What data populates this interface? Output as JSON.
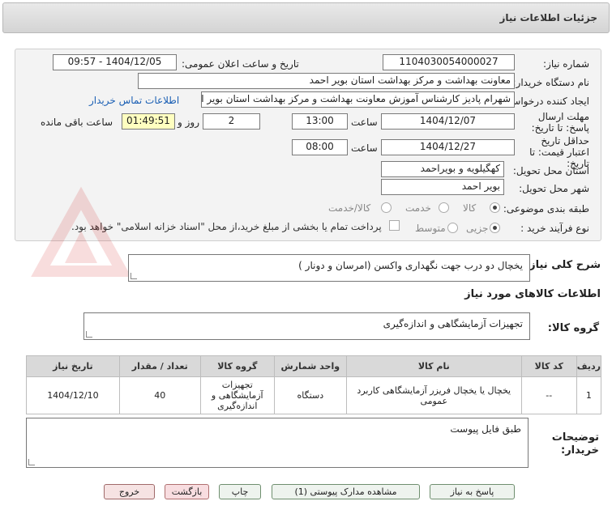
{
  "header": {
    "title": "جزئیات اطلاعات نیاز"
  },
  "fields": {
    "need_number_label": "شماره نیاز:",
    "need_number": "1104030054000027",
    "announce_label": "تاریخ و ساعت اعلان عمومی:",
    "announce_value": "1404/12/05 - 09:57",
    "buyer_org_label": "نام دستگاه خریدار:",
    "buyer_org": "معاونت بهداشت و مرکز بهداشت استان بویر احمد",
    "requester_label": "ایجاد کننده درخواست:",
    "requester": "شهرام پادیز کارشناس آموزش معاونت بهداشت و مرکز بهداشت استان بویر احمد",
    "contact_link": "اطلاعات تماس خریدار",
    "deadline_label": "مهلت ارسال پاسخ: تا تاریخ:",
    "deadline_date": "1404/12/07",
    "time_label": "ساعت",
    "deadline_time": "13:00",
    "days_value": "2",
    "days_label": "روز و",
    "remaining_time": "01:49:51",
    "remaining_label": "ساعت باقی مانده",
    "validity_label": "حداقل تاریخ اعتبار قیمت: تا تاریخ:",
    "validity_date": "1404/12/27",
    "validity_time": "08:00",
    "province_label": "استان محل تحویل:",
    "province": "کهگیلویه و بویراحمد",
    "city_label": "شهر محل تحویل:",
    "city": "بویر احمد",
    "category_label": "طبقه بندی موضوعی:",
    "category_options": [
      "کالا",
      "خدمت",
      "کالا/خدمت"
    ],
    "process_label": "نوع فرآیند خرید :",
    "process_options": [
      "جزیی",
      "متوسط"
    ],
    "payment_note": "پرداخت تمام یا بخشی از مبلغ خرید،از محل \"اسناد خزانه اسلامی\" خواهد بود."
  },
  "summary": {
    "label": "شرح کلی نیاز:",
    "value": "یخچال دو درب  جهت نگهداری واکسن (امرسان و دونار )"
  },
  "goods_section": {
    "title": "اطلاعات کالاهای مورد نیاز",
    "group_label": "گروه کالا:",
    "group_value": "تجهیزات آزمایشگاهی و اندازه‌گیری"
  },
  "table": {
    "headers": [
      "ردیف",
      "کد کالا",
      "نام کالا",
      "واحد شمارش",
      "گروه کالا",
      "تعداد / مقدار",
      "تاریخ نیاز"
    ],
    "rows": [
      [
        "1",
        "--",
        "یخچال یا یخچال فریزر آزمایشگاهی کاربرد عمومی",
        "دستگاه",
        "تجهیزات آزمایشگاهی و اندازه‌گیری",
        "40",
        "1404/12/10"
      ]
    ]
  },
  "buyer_notes": {
    "label": "توضیحات خریدار:",
    "value": "طبق فایل پیوست"
  },
  "buttons": {
    "reply": "پاسخ به نیاز",
    "docs": "مشاهده مدارک پیوستی (1)",
    "print": "چاپ",
    "back": "بازگشت",
    "exit": "خروج"
  },
  "colors": {
    "link": "#1a5fb4",
    "remaining_bg": "#ffffc0"
  }
}
